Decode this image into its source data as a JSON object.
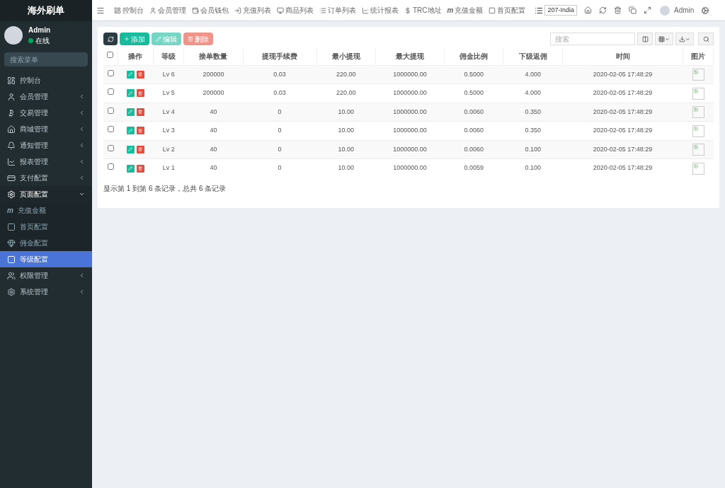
{
  "brand": "海外刷单",
  "user": {
    "name": "Admin",
    "status": "在线",
    "online": true
  },
  "menu_search": {
    "placeholder": "搜索菜单"
  },
  "menu": [
    {
      "label": "控制台",
      "expanded": false,
      "has_children": false,
      "selected": false
    },
    {
      "label": "会员管理",
      "expanded": false,
      "has_children": true,
      "selected": false
    },
    {
      "label": "交易管理",
      "expanded": false,
      "has_children": true,
      "selected": false
    },
    {
      "label": "商城管理",
      "expanded": false,
      "has_children": true,
      "selected": false
    },
    {
      "label": "通知管理",
      "expanded": false,
      "has_children": true,
      "selected": false
    },
    {
      "label": "报表管理",
      "expanded": false,
      "has_children": true,
      "selected": false
    },
    {
      "label": "支付配置",
      "expanded": false,
      "has_children": true,
      "selected": false
    },
    {
      "label": "页面配置",
      "expanded": true,
      "has_children": true,
      "selected": false,
      "children": [
        {
          "label": "充值金额",
          "icon_char": "m",
          "selected": false
        },
        {
          "label": "首页配置",
          "selected": false
        },
        {
          "label": "佣金配置",
          "selected": false
        },
        {
          "label": "等级配置",
          "selected": true
        }
      ]
    },
    {
      "label": "权限管理",
      "expanded": false,
      "has_children": true,
      "selected": false
    },
    {
      "label": "系统管理",
      "expanded": false,
      "has_children": true,
      "selected": false
    }
  ],
  "top_nav": [
    {
      "label": "控制台"
    },
    {
      "label": "会员管理"
    },
    {
      "label": "会员钱包"
    },
    {
      "label": "充值列表"
    },
    {
      "label": "商品列表"
    },
    {
      "label": "订单列表"
    },
    {
      "label": "统计报表"
    },
    {
      "label": "TRC地址"
    },
    {
      "label": "充值金额",
      "icon_char": "m"
    },
    {
      "label": "首页配置"
    }
  ],
  "site_select": "207-India",
  "header_user": "Admin",
  "toolbar": {
    "buttons": [
      {
        "label": "添加",
        "kind": "add",
        "disabled": false
      },
      {
        "label": "编辑",
        "kind": "edit",
        "disabled": true
      },
      {
        "label": "删除",
        "kind": "delete",
        "disabled": true
      }
    ],
    "search": {
      "placeholder": "搜索"
    }
  },
  "table": {
    "select_all_checked": false,
    "columns": [
      "操作",
      "等级",
      "接单数量",
      "提现手续费",
      "最小提现",
      "最大提现",
      "佣金比例",
      "下级返佣",
      "时间",
      "图片"
    ],
    "rows": [
      {
        "checked": false,
        "cells": [
          "",
          "Lv 6",
          "200000",
          "0.03",
          "220.00",
          "1000000.00",
          "0.5000",
          "4.000",
          "2020-02-05 17:48:29"
        ]
      },
      {
        "checked": false,
        "cells": [
          "",
          "Lv 5",
          "200000",
          "0.03",
          "220.00",
          "1000000.00",
          "0.5000",
          "4.000",
          "2020-02-05 17:48:29"
        ]
      },
      {
        "checked": false,
        "cells": [
          "",
          "Lv 4",
          "40",
          "0",
          "10.00",
          "1000000.00",
          "0.0060",
          "0.350",
          "2020-02-05 17:48:29"
        ]
      },
      {
        "checked": false,
        "cells": [
          "",
          "Lv 3",
          "40",
          "0",
          "10.00",
          "1000000.00",
          "0.0060",
          "0.350",
          "2020-02-05 17:48:29"
        ]
      },
      {
        "checked": false,
        "cells": [
          "",
          "Lv 2",
          "40",
          "0",
          "10.00",
          "1000000.00",
          "0.0060",
          "0.100",
          "2020-02-05 17:48:29"
        ]
      },
      {
        "checked": false,
        "cells": [
          "",
          "Lv 1",
          "40",
          "0",
          "10.00",
          "1000000.00",
          "0.0059",
          "0.100",
          "2020-02-05 17:48:29"
        ]
      }
    ]
  },
  "pagination_info": "显示第 1 到第 6 条记录，总共 6 条记录"
}
